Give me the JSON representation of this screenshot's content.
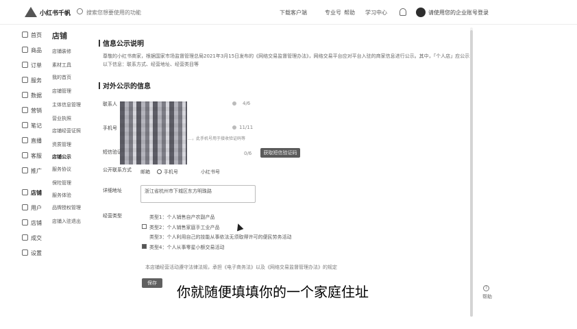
{
  "app": {
    "logo_text": "小红书千帆"
  },
  "search": {
    "placeholder": "搜索您想要使用的功能"
  },
  "topnav": [
    "下载客户端",
    "专业号",
    "帮助",
    "学习中心"
  ],
  "user": {
    "name": "请使用您的企业账号登录"
  },
  "leftnav": [
    "首页",
    "商品",
    "订单",
    "服务",
    "数据",
    "营销",
    "笔记",
    "直播",
    "客服",
    "推广",
    "店铺",
    "用户",
    "店铺",
    "成交",
    "设置"
  ],
  "subnav": {
    "title": "店铺",
    "items": [
      "店铺装修",
      "素材工具",
      "我的首页",
      "店铺管理",
      "主体信息管理",
      "营业执照",
      "店铺经营证照",
      "资质管理",
      "店铺公示",
      "服务协议",
      "保险管理",
      "服务体验",
      "品牌授权管理",
      "店铺入驻退出"
    ]
  },
  "section1": {
    "title": "信息公示说明",
    "text": "尊敬的小红书商家，根据国家市场监督管理总局2021年3月15日发布的《网络交易监督管理办法》，网络交易平台应对平台入驻的商家信息进行公示。其中，「个人店」应公示以下信息：联系方式、经营地址、经营类目等"
  },
  "section2": {
    "title": "对外公示的信息",
    "contact_label": "联系人",
    "contact_count": "4/6",
    "phone_label": "手机号",
    "phone_count": "11/11",
    "phone_note": "…，此手机号用于接收验证码等",
    "code_label": "短信验证码",
    "code_count": "0/6",
    "get_code": "获取短信验证码",
    "public_contact_label": "公开联系方式",
    "radio_options": [
      "邮箱",
      "手机号",
      "小红书号"
    ],
    "address_label": "详细地址",
    "address_value": "浙江省杭州市下城区东方明珠路",
    "type_label": "经营类型",
    "types": [
      "类型1：个人销售自产农副产品",
      "类型2：个人销售家庭手工业产品",
      "类型3：个人利用自己的技能从事依法无须取得许可的便民劳务活动",
      "类型4：个人从事零星小额交易活动"
    ],
    "footnote": "本店铺经营活动遵守法律法规，承担《电子商务法》以及《网络交易监督管理办法》的规定",
    "save": "保存"
  },
  "help": {
    "label": "帮助"
  },
  "caption": "你就随便填填你的一个家庭住址"
}
